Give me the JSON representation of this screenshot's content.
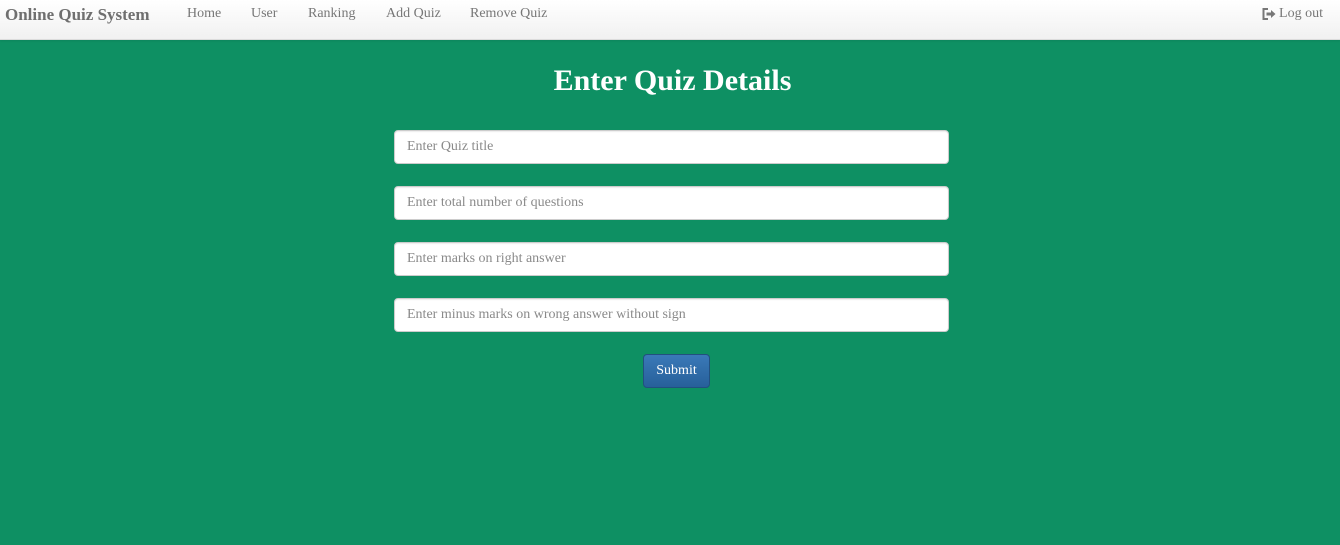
{
  "nav": {
    "brand": "Online Quiz System",
    "items": [
      {
        "label": "Home"
      },
      {
        "label": "User"
      },
      {
        "label": "Ranking"
      },
      {
        "label": "Add Quiz"
      },
      {
        "label": "Remove Quiz"
      }
    ],
    "logout_label": "Log out",
    "logout_icon": "log-out-icon"
  },
  "form": {
    "title": "Enter Quiz Details",
    "fields": [
      {
        "placeholder": "Enter Quiz title",
        "value": ""
      },
      {
        "placeholder": "Enter total number of questions",
        "value": ""
      },
      {
        "placeholder": "Enter marks on right answer",
        "value": ""
      },
      {
        "placeholder": "Enter minus marks on wrong answer without sign",
        "value": ""
      }
    ],
    "submit_label": "Submit"
  },
  "colors": {
    "background": "#0e9063",
    "submit": "#2e6da4",
    "navbar": "#f8f8f8"
  }
}
